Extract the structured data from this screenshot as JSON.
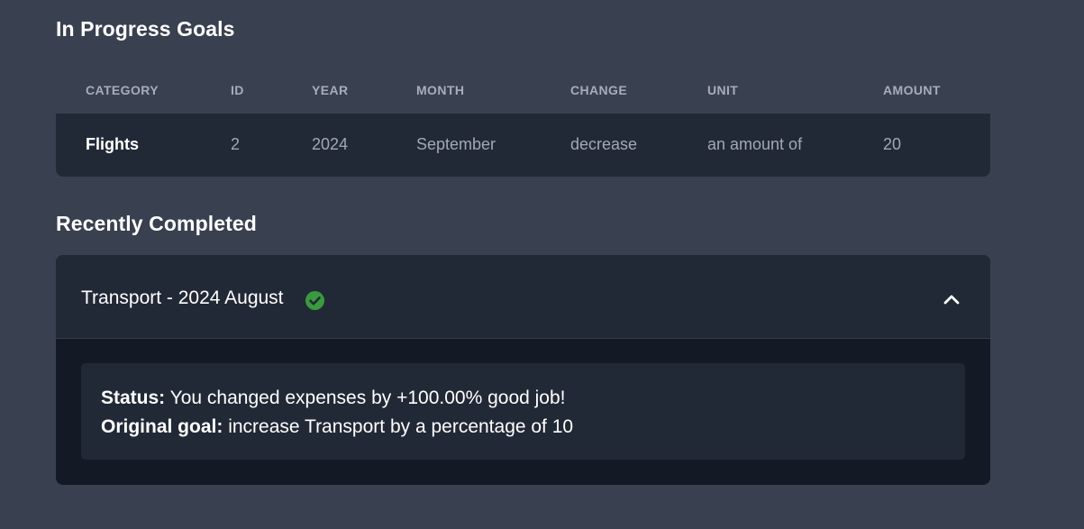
{
  "in_progress": {
    "title": "In Progress Goals",
    "columns": [
      "CATEGORY",
      "ID",
      "YEAR",
      "MONTH",
      "CHANGE",
      "UNIT",
      "AMOUNT"
    ],
    "rows": [
      [
        "Flights",
        "2",
        "2024",
        "September",
        "decrease",
        "an amount of",
        "20"
      ]
    ]
  },
  "recently_completed": {
    "title": "Recently Completed",
    "items": [
      {
        "title": "Transport - 2024 August",
        "status_icon": "check-circle-icon",
        "status_icon_color": "#3a9a3e",
        "toggle_icon": "chevron-up-icon",
        "status_label": "Status:",
        "status_text": "You changed expenses by +100.00% good job!",
        "goal_label": "Original goal:",
        "goal_text": "increase Transport by a percentage of 10"
      }
    ]
  },
  "colors": {
    "page_bg": "#394050",
    "card_bg": "#222936",
    "accordion_body_bg": "#131925",
    "header_text": "#a7adb8",
    "muted_text": "#a2a8b3"
  }
}
